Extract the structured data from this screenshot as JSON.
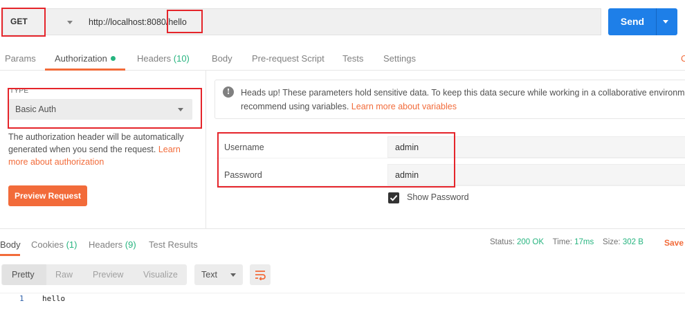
{
  "request": {
    "method": "GET",
    "url": "http://localhost:8080/hello",
    "send_label": "Send"
  },
  "request_tabs": [
    {
      "label": "Params",
      "count": ""
    },
    {
      "label": "Authorization",
      "count": ""
    },
    {
      "label": "Headers",
      "count": "(10)"
    },
    {
      "label": "Body",
      "count": ""
    },
    {
      "label": "Pre-request Script",
      "count": ""
    },
    {
      "label": "Tests",
      "count": ""
    },
    {
      "label": "Settings",
      "count": ""
    }
  ],
  "cookies_edge": "C",
  "auth": {
    "type_label": "TYPE",
    "type_value": "Basic Auth",
    "help_text": "The authorization header will be automatically generated when you send the request. ",
    "help_link": "Learn more about authorization",
    "preview_button": "Preview Request",
    "notice_text_line1": "Heads up! These parameters hold sensitive data. To keep this data secure while working in a collaborative environme",
    "notice_text_line2": "recommend using variables. ",
    "notice_link": "Learn more about variables",
    "fields": [
      {
        "label": "Username",
        "value": "admin"
      },
      {
        "label": "Password",
        "value": "admin"
      }
    ],
    "show_password_label": "Show Password",
    "show_password_checked": true
  },
  "response": {
    "tabs": [
      {
        "label": "Body",
        "count": ""
      },
      {
        "label": "Cookies",
        "count": "(1)"
      },
      {
        "label": "Headers",
        "count": "(9)"
      },
      {
        "label": "Test Results",
        "count": ""
      }
    ],
    "status_label": "Status:",
    "status_value": "200 OK",
    "time_label": "Time:",
    "time_value": "17ms",
    "size_label": "Size:",
    "size_value": "302 B",
    "save_label": "Save",
    "view_options": [
      "Pretty",
      "Raw",
      "Preview",
      "Visualize"
    ],
    "format": "Text",
    "lines": [
      {
        "no": "1",
        "text": "hello"
      }
    ]
  },
  "colors": {
    "accent": "#f26b3a",
    "send": "#1e7fe8",
    "count": "#26b47f",
    "annotation": "#e5242a"
  }
}
